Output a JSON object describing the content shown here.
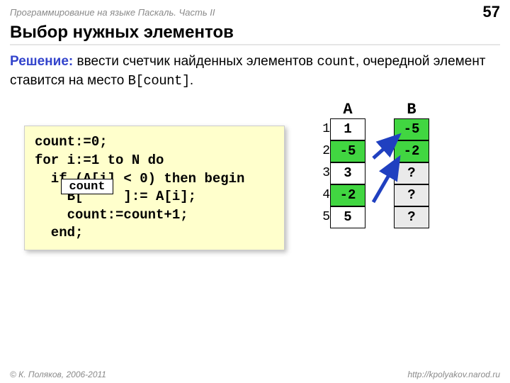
{
  "header": {
    "course": "Программирование на языке Паскаль. Часть II",
    "page": "57"
  },
  "title": "Выбор нужных элементов",
  "desc": {
    "kw": "Решение:",
    "t1": " ввести счетчик найденных элементов ",
    "code1": "count",
    "t2": ", очередной элемент ставится на место ",
    "code2": "B[count]",
    "t3": "."
  },
  "code": {
    "l1": "count:=0;",
    "l2": "for i:=1 to N do",
    "l3": "  if (A[i] < 0) then begin",
    "l4a": "    B[",
    "l4b": "     ]:= A[i];",
    "l5": "    count:=count+1;",
    "l6": "  end;",
    "blank": "count"
  },
  "arrays": {
    "A_label": "A",
    "B_label": "B",
    "idx": [
      "1",
      "2",
      "3",
      "4",
      "5"
    ],
    "A": [
      {
        "v": "1",
        "neg": false
      },
      {
        "v": "-5",
        "neg": true
      },
      {
        "v": "3",
        "neg": false
      },
      {
        "v": "-2",
        "neg": true
      },
      {
        "v": "5",
        "neg": false
      }
    ],
    "B": [
      {
        "v": "-5",
        "cls": "neg"
      },
      {
        "v": "-2",
        "cls": "neg"
      },
      {
        "v": "?",
        "cls": "gray"
      },
      {
        "v": "?",
        "cls": "gray"
      },
      {
        "v": "?",
        "cls": "gray"
      }
    ]
  },
  "footer": {
    "copyright": "© К. Поляков, 2006-2011",
    "url": "http://kpolyakov.narod.ru"
  }
}
